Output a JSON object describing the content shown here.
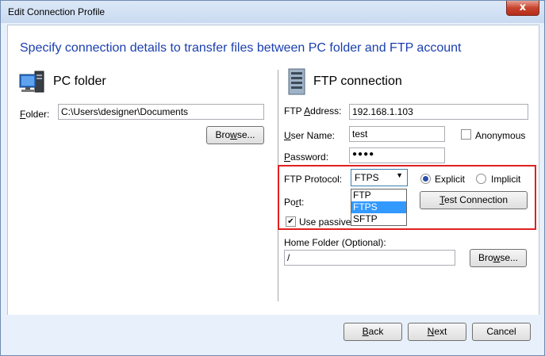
{
  "window": {
    "title": "Edit Connection Profile",
    "close_glyph": "x"
  },
  "heading": "Specify connection details to transfer files between PC folder and FTP account",
  "pc": {
    "section_title": "PC folder",
    "folder_label_ul": "F",
    "folder_label_rest": "older:",
    "folder_value": "C:\\Users\\designer\\Documents",
    "browse_ul": "w",
    "browse_pre": "Bro",
    "browse_post": "se..."
  },
  "ftp": {
    "section_title": "FTP connection",
    "address_label_pre": "FTP ",
    "address_label_ul": "A",
    "address_label_post": "ddress:",
    "address_value": "192.168.1.103",
    "username_label_ul": "U",
    "username_label_rest": "ser Name:",
    "username_value": "test",
    "anonymous_label": "Anonymous",
    "anonymous_checked": false,
    "password_label_ul": "P",
    "password_label_rest": "assword:",
    "password_value": "●●●●",
    "protocol_label": "FTP Protocol:",
    "protocol_value": "FTPS",
    "protocol_arrow": "▼",
    "protocol_options": [
      "FTP",
      "FTPS",
      "SFTP"
    ],
    "explicit_label": "Explicit",
    "implicit_label": "Implicit",
    "mode_selected": "Explicit",
    "port_label_pre": "Po",
    "port_label_ul": "r",
    "port_label_post": "t:",
    "test_connection_ul": "T",
    "test_connection_rest": "est Connection",
    "passive_label_visible": "Use passive mode",
    "passive_checked": true,
    "passive_check_glyph": "✔",
    "home_folder_label": "Home Folder (Optional):",
    "home_folder_value": "/",
    "browse_ul": "w",
    "browse_pre": "Bro",
    "browse_post": "se..."
  },
  "footer": {
    "back_ul": "B",
    "back_rest": "ack",
    "next_ul": "N",
    "next_rest": "ext",
    "cancel_label": "Cancel"
  }
}
